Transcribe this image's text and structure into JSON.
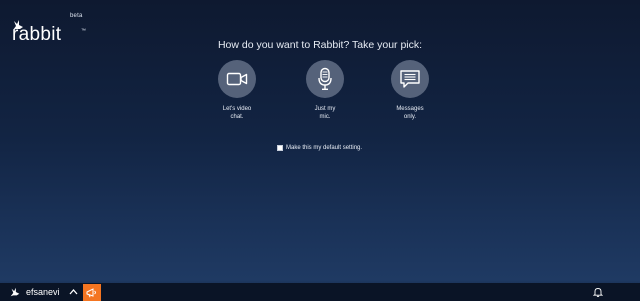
{
  "brand": {
    "beta_label": "beta",
    "name": "rabbit",
    "trademark": "™"
  },
  "chooser": {
    "prompt": "How do you want to Rabbit? Take your pick:",
    "options": [
      {
        "id": "video",
        "icon": "video-camera-icon",
        "line1": "Let's video",
        "line2": "chat."
      },
      {
        "id": "mic",
        "icon": "microphone-icon",
        "line1": "Just my",
        "line2": "mic."
      },
      {
        "id": "messages",
        "icon": "chat-bubble-icon",
        "line1": "Messages",
        "line2": "only."
      }
    ],
    "default_setting_label": "Make this my default setting.",
    "default_setting_checked": false
  },
  "bottom_bar": {
    "username": "efsanevi",
    "user_icon": "rabbit-icon",
    "expand_icon": "chevron-up-icon",
    "action_icon": "megaphone-icon",
    "notification_icon": "bell-icon",
    "accent_color": "#f47521"
  }
}
